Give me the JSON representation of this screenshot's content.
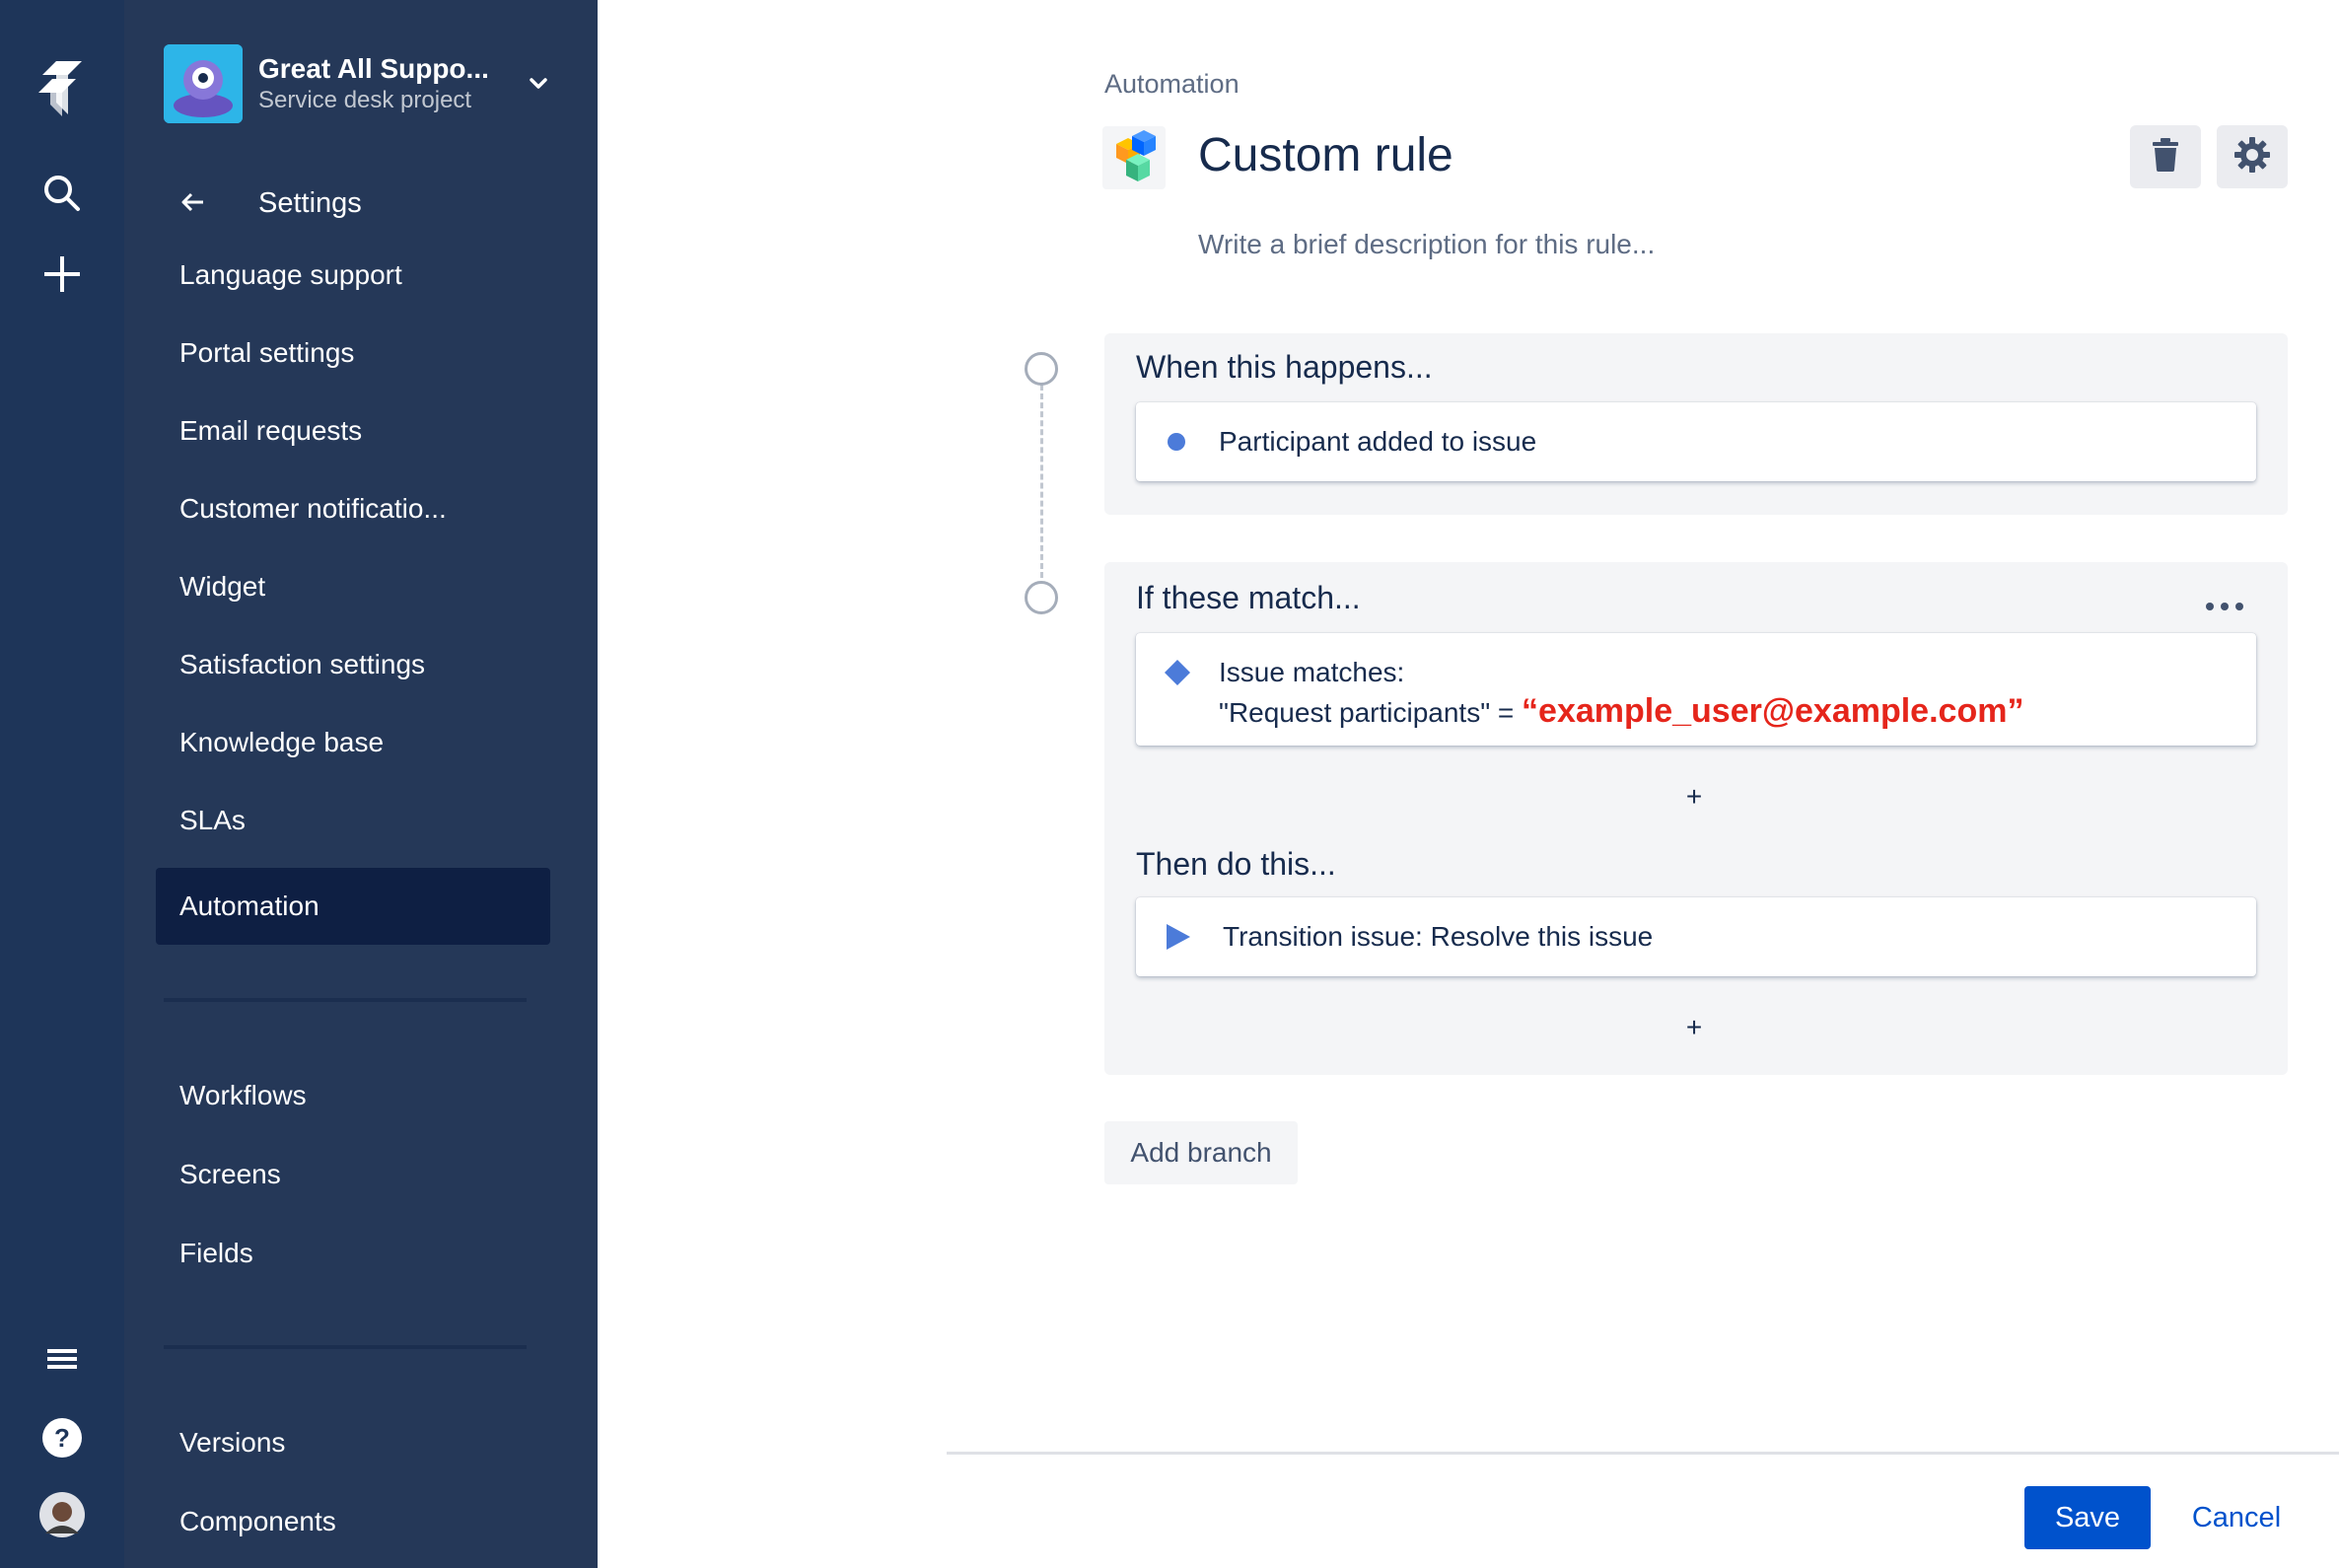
{
  "project": {
    "name": "Great All Suppo...",
    "type": "Service desk project"
  },
  "sidebar": {
    "back_label": "Settings",
    "items": [
      {
        "label": "Language support"
      },
      {
        "label": "Portal settings"
      },
      {
        "label": "Email requests"
      },
      {
        "label": "Customer notificatio..."
      },
      {
        "label": "Widget"
      },
      {
        "label": "Satisfaction settings"
      },
      {
        "label": "Knowledge base"
      },
      {
        "label": "SLAs"
      },
      {
        "label": "Automation",
        "active": true
      }
    ],
    "group2": [
      {
        "label": "Workflows"
      },
      {
        "label": "Screens"
      },
      {
        "label": "Fields"
      }
    ],
    "group3": [
      {
        "label": "Versions"
      },
      {
        "label": "Components"
      }
    ]
  },
  "header": {
    "breadcrumb": "Automation",
    "title": "Custom rule",
    "description_placeholder": "Write a brief description for this rule..."
  },
  "rule": {
    "trigger": {
      "heading": "When this happens...",
      "item": "Participant added to issue"
    },
    "condition": {
      "heading": "If these match...",
      "line1": "Issue matches:",
      "line2_prefix": "\"Request participants\" = ",
      "line2_value": "“example_user@example.com”"
    },
    "action": {
      "heading": "Then do this...",
      "item": "Transition issue: Resolve this issue"
    },
    "add_symbol": "+"
  },
  "buttons": {
    "add_branch": "Add branch",
    "save": "Save",
    "cancel": "Cancel"
  },
  "colors": {
    "global_nav": "#1E3559",
    "sidebar": "#253858",
    "sidebar_active": "#0E1F43",
    "primary": "#0052CC",
    "highlight_red": "#E5251B",
    "accent_blue": "#4C7BD9"
  }
}
